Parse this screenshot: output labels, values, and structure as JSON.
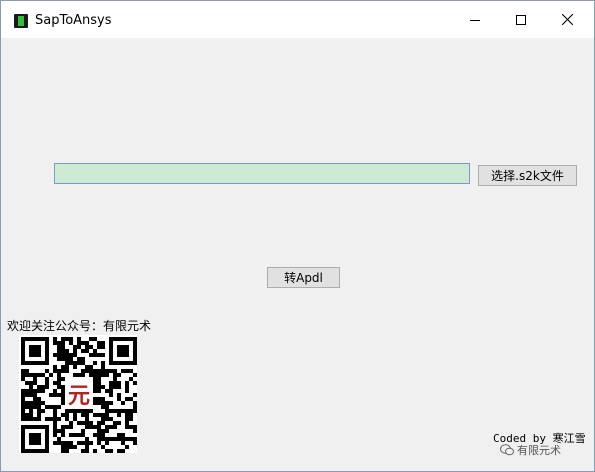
{
  "window": {
    "title": "SapToAnsys"
  },
  "main": {
    "path_value": "",
    "browse_label": "选择.s2k文件",
    "convert_label": "转Apdl",
    "qr_caption": "欢迎关注公众号：有限元术",
    "qr_logo_char": "元",
    "credit": "Coded by 寒江雪",
    "watermark": "有限元术"
  },
  "colors": {
    "input_bg": "#ccebd2",
    "input_border": "#7a9bd0",
    "window_bg": "#f0f0f0",
    "qr_logo": "#b22222"
  },
  "icons": {
    "app": "app-icon",
    "minimize": "minimize-icon",
    "maximize": "maximize-icon",
    "close": "close-icon",
    "wechat": "wechat-icon"
  }
}
